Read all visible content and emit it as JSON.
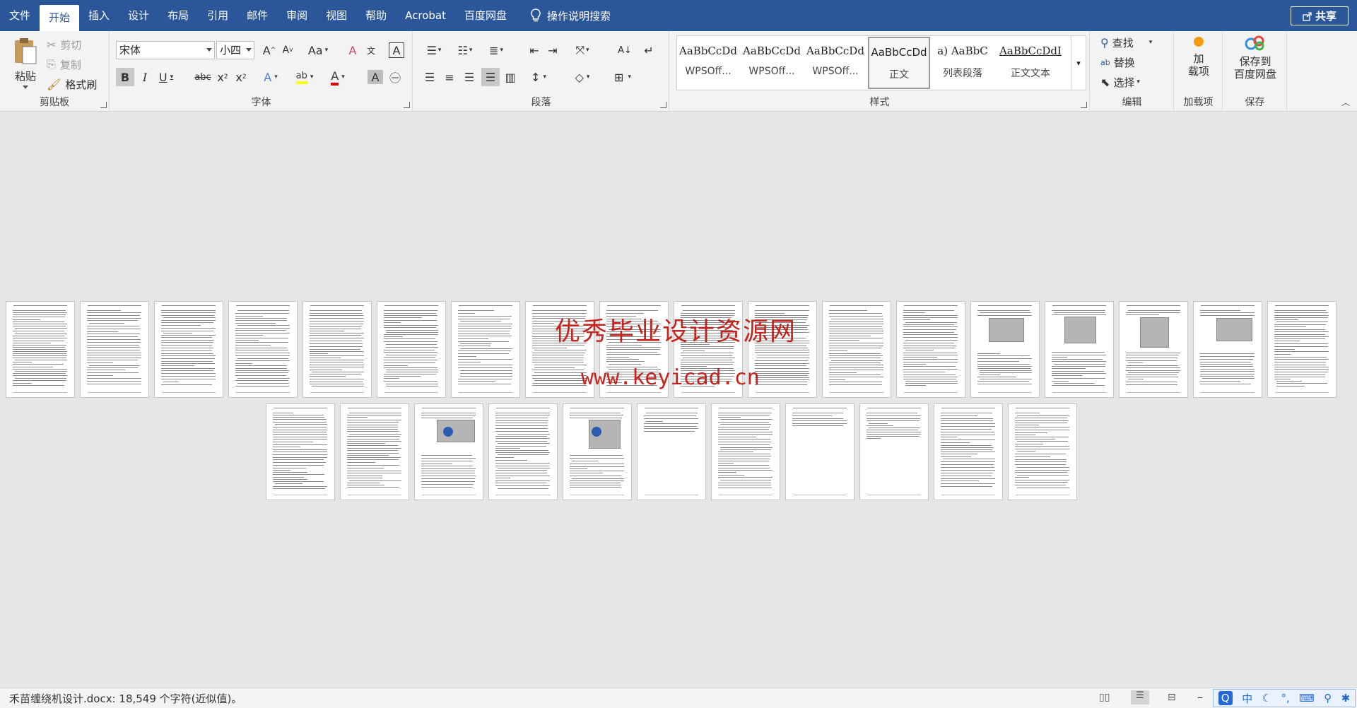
{
  "tabs": [
    "文件",
    "开始",
    "插入",
    "设计",
    "布局",
    "引用",
    "邮件",
    "审阅",
    "视图",
    "帮助",
    "Acrobat",
    "百度网盘"
  ],
  "active_tab": "开始",
  "tell_me": "操作说明搜索",
  "share_label": "共享",
  "clipboard": {
    "label": "剪贴板",
    "paste": "粘贴",
    "cut": "剪切",
    "copy": "复制",
    "format_painter": "格式刷"
  },
  "font": {
    "label": "字体",
    "name": "宋体",
    "size": "小四"
  },
  "paragraph": {
    "label": "段落"
  },
  "styles": {
    "label": "样式",
    "items": [
      {
        "preview": "AaBbCcDd",
        "name": "WPSOff..."
      },
      {
        "preview": "AaBbCcDd",
        "name": "WPSOff..."
      },
      {
        "preview": "AaBbCcDd",
        "name": "WPSOff..."
      },
      {
        "preview": "AaBbCcDd",
        "name": "正文"
      },
      {
        "preview": "a)  AaBbC",
        "name": "列表段落"
      },
      {
        "preview": "AaBbCcDdI",
        "name": "正文文本"
      }
    ]
  },
  "editing": {
    "label": "编辑",
    "find": "查找",
    "replace": "替换",
    "select": "选择"
  },
  "addins": {
    "label": "加载项",
    "button": "加\n载项"
  },
  "save": {
    "label": "保存",
    "button": "保存到\n百度网盘"
  },
  "watermark": {
    "line1": "优秀毕业设计资源网",
    "line2": "www.keyicad.cn"
  },
  "status": {
    "text": "禾苗缠绕机设计.docx: 18,549 个字符(近似值)。"
  },
  "ime": {
    "lang": "中"
  },
  "colors": {
    "accent": "#2b579a",
    "watermark": "#c8221c",
    "highlight": "#ffff00",
    "font_red": "#e00000"
  },
  "pages_row1": 18,
  "pages_row2": 11
}
